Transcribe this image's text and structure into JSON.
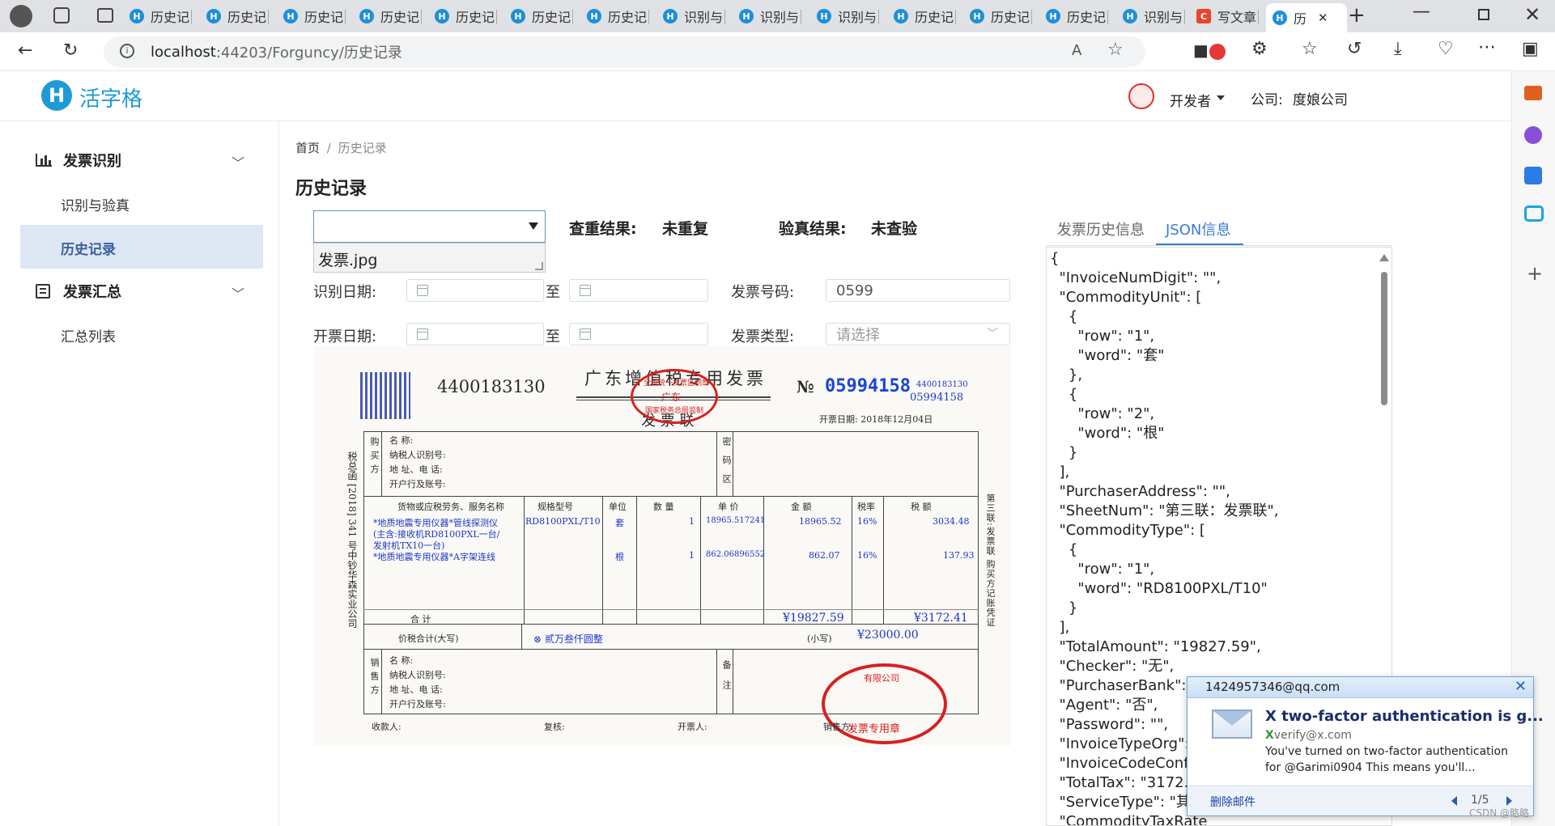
{
  "browser": {
    "tabs": [
      {
        "label": "历史记"
      },
      {
        "label": "历史记"
      },
      {
        "label": "历史记"
      },
      {
        "label": "历史记"
      },
      {
        "label": "历史记"
      },
      {
        "label": "历史记"
      },
      {
        "label": "历史记"
      },
      {
        "label": "识别与"
      },
      {
        "label": "识别与"
      },
      {
        "label": "识别与"
      },
      {
        "label": "历史记"
      },
      {
        "label": "历史记"
      },
      {
        "label": "历史记"
      },
      {
        "label": "识别与"
      },
      {
        "label": "写文章"
      },
      {
        "label": "历"
      }
    ],
    "url_host": "localhost",
    "url_rest": ":44203/Forguncy/历史记录"
  },
  "header": {
    "logo_text": "活字格",
    "user_name": "开发者",
    "company_label": "公司:",
    "company_name": "度娘公司"
  },
  "sidebar": {
    "groups": [
      {
        "label": "发票识别",
        "items": [
          {
            "label": "识别与验真"
          },
          {
            "label": "历史记录"
          }
        ]
      },
      {
        "label": "发票汇总",
        "items": [
          {
            "label": "汇总列表"
          }
        ]
      }
    ]
  },
  "breadcrumb": {
    "home": "首页",
    "sep": "/",
    "current": "历史记录"
  },
  "page_title": "历史记录",
  "filters": {
    "file_select_value": "",
    "file_option": "发票.jpg",
    "dup_label": "查重结果:",
    "dup_value": "未重复",
    "verify_label": "验真结果:",
    "verify_value": "未查验",
    "recog_date_label": "识别日期:",
    "to_label": "至",
    "invoice_no_label": "发票号码:",
    "invoice_no_value": "0599",
    "issue_date_label": "开票日期:",
    "invoice_type_label": "发票类型:",
    "invoice_type_placeholder": "请选择"
  },
  "right_tabs": {
    "history": "发票历史信息",
    "json": "JSON信息"
  },
  "json_text": "{\n  \"InvoiceNumDigit\": \"\",\n  \"CommodityUnit\": [\n    {\n      \"row\": \"1\",\n      \"word\": \"套\"\n    },\n    {\n      \"row\": \"2\",\n      \"word\": \"根\"\n    }\n  ],\n  \"PurchaserAddress\": \"\",\n  \"SheetNum\": \"第三联：发票联\",\n  \"CommodityType\": [\n    {\n      \"row\": \"1\",\n      \"word\": \"RD8100PXL/T10\"\n    }\n  ],\n  \"TotalAmount\": \"19827.59\",\n  \"Checker\": \"无\",\n  \"PurchaserBank\": \"\n  \"Agent\": \"否\",\n  \"Password\": \"\",\n  \"InvoiceTypeOrg\":\n  \"InvoiceCodeConf\n  \"TotalTax\": \"3172.4\n  \"ServiceType\": \"其\n  \"CommodityTaxRate",
  "invoice": {
    "code_left": "4400183130",
    "title": "广东增值税专用发票",
    "no_symbol": "№",
    "number": "05994158",
    "code_small": "4400183130",
    "number_small": "05994158",
    "issue_date": "开票日期: 2018年12月04日",
    "copy_name": "发 票 联",
    "buyer": "购买方",
    "name_row": "名    称:",
    "taxid_row": "纳税人识别号:",
    "addr_row": "地 址、电 话:",
    "bank_row": "开户行及账号:",
    "pwd_area": "密码区",
    "col_goods": "货物或应税劳务、服务名称",
    "col_spec": "规格型号",
    "col_unit": "单位",
    "col_qty": "数 量",
    "col_price": "单 价",
    "col_amount": "金 额",
    "col_rate": "税率",
    "col_tax": "税 额",
    "item1_name": "*地质地震专用仪器*管线探测仪",
    "item1_name2": "(主含:接收机RD8100PXL一台/",
    "item1_name3": "发射机TX10一台)",
    "item1_spec": "RD8100PXL/T10",
    "item1_unit": "套",
    "item1_qty": "1",
    "item1_price": "18965.517241",
    "item1_amount": "18965.52",
    "item1_rate": "16%",
    "item1_tax": "3034.48",
    "item2_name": "*地质地震专用仪器*A字架连线",
    "item2_unit": "根",
    "item2_qty": "1",
    "item2_price": "862.06896552",
    "item2_amount": "862.07",
    "item2_rate": "16%",
    "item2_tax": "137.93",
    "total_label": "合      计",
    "total_amount": "¥19827.59",
    "total_tax": "¥3172.41",
    "price_tax_label": "价税合计(大写)",
    "price_tax_words": "⊗ 贰万叁仟圆整",
    "small_label": "(小写)",
    "small_value": "¥23000.00",
    "seller": "销售方",
    "remarks": "备注",
    "payee": "收款人:",
    "reviewer": "复核:",
    "drawer": "开票人:",
    "seller_sign": "销售方:",
    "side_text": "税总函 [2018] 341 号中钞华森实业公司",
    "right_side": "第三联:发票联 购买方记账凭证",
    "stamp_top": "全国统一发票监制章",
    "stamp_mid": "广东",
    "stamp_bot": "国家税务总局监制",
    "stamp2_text": "发票专用章",
    "stamp2_top": "有限公司"
  },
  "notification": {
    "account": "1424957346@qq.com",
    "title": "X two-factor authentication is g...",
    "sender_prefix": "X",
    "sender": "verify@x.com",
    "body1": "You've turned on two-factor authentication",
    "body2": "for @Garimi0904    This means you'll...",
    "delete_label": "删除邮件",
    "pager": "1/5"
  },
  "watermark": "CSDN @略略"
}
